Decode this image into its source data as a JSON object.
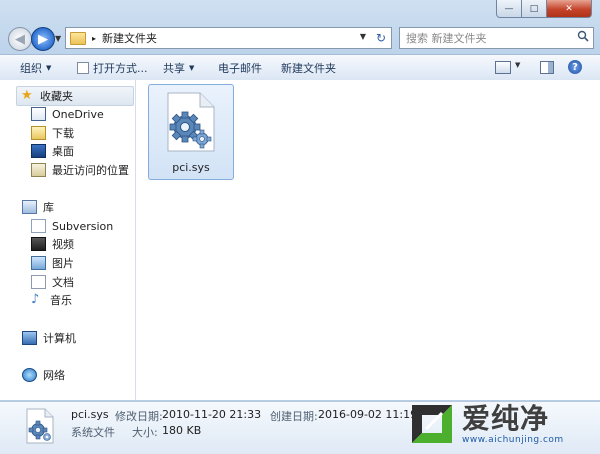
{
  "window": {
    "buttons": {
      "minimize": "—",
      "maximize": "□",
      "close": "✕"
    }
  },
  "address_bar": {
    "back_glyph": "◀",
    "forward_glyph": "▶",
    "breadcrumb_separator": "▸",
    "path": "新建文件夹",
    "refresh_glyph": "↻"
  },
  "search": {
    "placeholder": "搜索 新建文件夹",
    "icon": "search-icon"
  },
  "toolbar": {
    "organize": "组织",
    "open_with": "打开方式...",
    "share": "共享",
    "email": "电子邮件",
    "new_folder": "新建文件夹",
    "help": "?"
  },
  "nav": {
    "favorites": "收藏夹",
    "onedrive": "OneDrive",
    "downloads": "下载",
    "desktop": "桌面",
    "recent": "最近访问的位置",
    "libraries": "库",
    "subversion": "Subversion",
    "videos": "视频",
    "pictures": "图片",
    "documents": "文档",
    "music": "音乐",
    "computer": "计算机",
    "network": "网络"
  },
  "files": [
    {
      "name": "pci.sys",
      "icon": "system-file-gear-icon",
      "selected": true
    }
  ],
  "details": {
    "name": "pci.sys",
    "type": "系统文件",
    "modified_label": "修改日期:",
    "modified": "2010-11-20 21:33",
    "size_label": "大小:",
    "size": "180 KB",
    "created_label": "创建日期:",
    "created": "2016-09-02 11:19"
  },
  "watermark": {
    "title": "爱纯净",
    "url": "www.aichunjing.com"
  },
  "colors": {
    "frame": "#bcd3eb",
    "selection": "#d2e3f6",
    "selection_border": "#84acdd",
    "close_button": "#c4442b"
  }
}
